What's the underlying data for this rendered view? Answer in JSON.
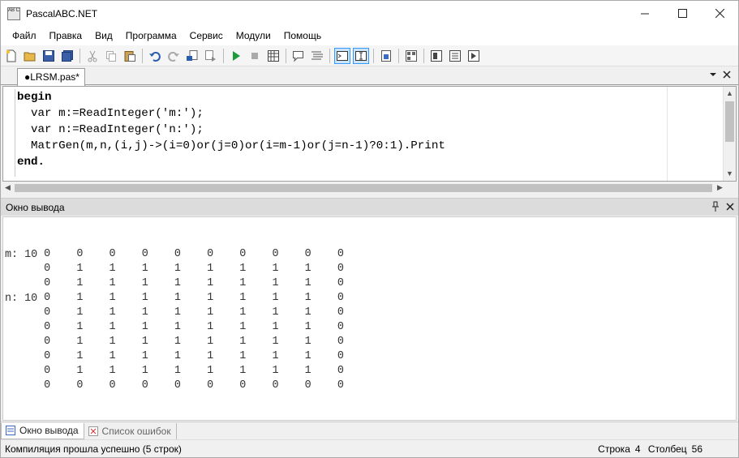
{
  "window": {
    "title": "PascalABC.NET",
    "icon_text": "AB C"
  },
  "menu": [
    "Файл",
    "Правка",
    "Вид",
    "Программа",
    "Сервис",
    "Модули",
    "Помощь"
  ],
  "document_tab": {
    "label": "●LRSM.pas*"
  },
  "editor": {
    "lines": [
      "begin",
      "  var m:=ReadInteger('m:');",
      "  var n:=ReadInteger('n:');",
      "  MatrGen(m,n,(i,j)->(i=0)or(j=0)or(i=m-1)or(j=n-1)?0:1).Print",
      "end."
    ]
  },
  "output_panel": {
    "title": "Окно вывода",
    "prompt_lines": [
      "m: 10",
      "n: 10"
    ],
    "matrix": [
      [
        0,
        0,
        0,
        0,
        0,
        0,
        0,
        0,
        0,
        0
      ],
      [
        0,
        1,
        1,
        1,
        1,
        1,
        1,
        1,
        1,
        0
      ],
      [
        0,
        1,
        1,
        1,
        1,
        1,
        1,
        1,
        1,
        0
      ],
      [
        0,
        1,
        1,
        1,
        1,
        1,
        1,
        1,
        1,
        0
      ],
      [
        0,
        1,
        1,
        1,
        1,
        1,
        1,
        1,
        1,
        0
      ],
      [
        0,
        1,
        1,
        1,
        1,
        1,
        1,
        1,
        1,
        0
      ],
      [
        0,
        1,
        1,
        1,
        1,
        1,
        1,
        1,
        1,
        0
      ],
      [
        0,
        1,
        1,
        1,
        1,
        1,
        1,
        1,
        1,
        0
      ],
      [
        0,
        1,
        1,
        1,
        1,
        1,
        1,
        1,
        1,
        0
      ],
      [
        0,
        0,
        0,
        0,
        0,
        0,
        0,
        0,
        0,
        0
      ]
    ]
  },
  "bottom_tabs": [
    "Окно вывода",
    "Список ошибок"
  ],
  "status": {
    "message": "Компиляция прошла успешно (5 строк)",
    "row_label": "Строка",
    "row_value": "4",
    "col_label": "Столбец",
    "col_value": "56"
  },
  "colors": {
    "keyword": "#000000",
    "string": "#0000ff",
    "active_tool": "#cce4f7"
  }
}
